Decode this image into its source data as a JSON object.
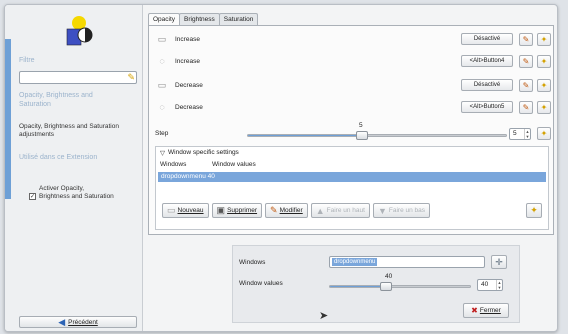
{
  "sidebar": {
    "filter_label": "Filtre",
    "filter_value": "",
    "category1_title": "Opacity, Brightness and Saturation",
    "category1_desc": "Opacity, Brightness and Saturation adjustments",
    "category2_title": "Utilisé dans ce Extension",
    "check_label": "Activer Opacity, Brightness and Saturation",
    "check_checked": "✓",
    "prev_button": "Précédent"
  },
  "tabs": [
    "Opacity",
    "Brightness",
    "Saturation"
  ],
  "actions": [
    {
      "label": "Increase",
      "shortcut": "Désactivé"
    },
    {
      "label": "Increase",
      "shortcut": "<Alt>Button4"
    },
    {
      "label": "Decrease",
      "shortcut": "Désactivé"
    },
    {
      "label": "Decrease",
      "shortcut": "<Alt>Button5"
    }
  ],
  "step": {
    "label": "Step",
    "value": "5",
    "min": 0,
    "max": 100,
    "level": 5
  },
  "window_settings": {
    "title": "Window specific settings",
    "col_windows": "Windows",
    "col_values": "Window values",
    "row_windows": "dropdownmenu",
    "row_value": "40"
  },
  "buttons": {
    "new": "Nouveau",
    "delete": "Supprimer",
    "modify": "Modifier",
    "up": "Faire un haut",
    "down": "Faire un bas"
  },
  "editor": {
    "windows_label": "Windows",
    "windows_value": "dropdownmenu",
    "values_label": "Window values",
    "values_value": "40",
    "close_button": "Fermer",
    "level": 40
  },
  "colors": {
    "accent": "#6e9fd6",
    "selection": "#7aa6db"
  }
}
